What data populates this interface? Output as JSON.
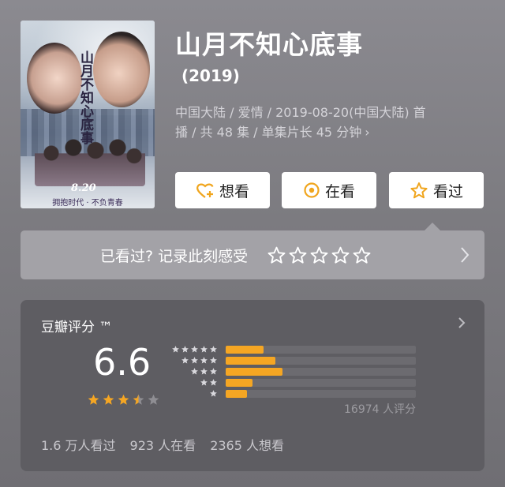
{
  "movie": {
    "title": "山月不知心底事",
    "year": "(2019)",
    "meta_line1": "中国大陆 / 爱情 / 2019-08-20(中国大陆) 首",
    "meta_line2": "播 / 共 48 集 / 单集片长 45 分钟",
    "meta_chevron": "›",
    "poster": {
      "title_vertical": "山月不知心底事",
      "date": "8.20",
      "slogan": "拥抱时代 · 不负青春"
    }
  },
  "actions": {
    "want": {
      "label": "想看",
      "icon": "heart-plus-icon"
    },
    "doing": {
      "label": "在看",
      "icon": "target-icon"
    },
    "done": {
      "label": "看过",
      "icon": "star-outline-icon"
    }
  },
  "mark": {
    "prompt": "已看过? 记录此刻感受",
    "stars": 5,
    "icon": "chevron-right-icon"
  },
  "rating": {
    "label": "豆瓣评分 ™",
    "score": "6.6",
    "stars_value": 3.5,
    "stars_max": 5,
    "distribution": [
      {
        "stars": 5,
        "fraction": 0.2
      },
      {
        "stars": 4,
        "fraction": 0.26
      },
      {
        "stars": 3,
        "fraction": 0.3
      },
      {
        "stars": 2,
        "fraction": 0.14
      },
      {
        "stars": 1,
        "fraction": 0.11
      }
    ],
    "count": "16974 人评分",
    "stats": {
      "seen": "1.6 万人看过",
      "watching": "923 人在看",
      "want": "2365 人想看"
    }
  },
  "colors": {
    "accent": "#f5a623",
    "accent_button_icon": "#f0a51d",
    "panel": "#5e5d62",
    "mark_bar": "#a3a2a7"
  }
}
